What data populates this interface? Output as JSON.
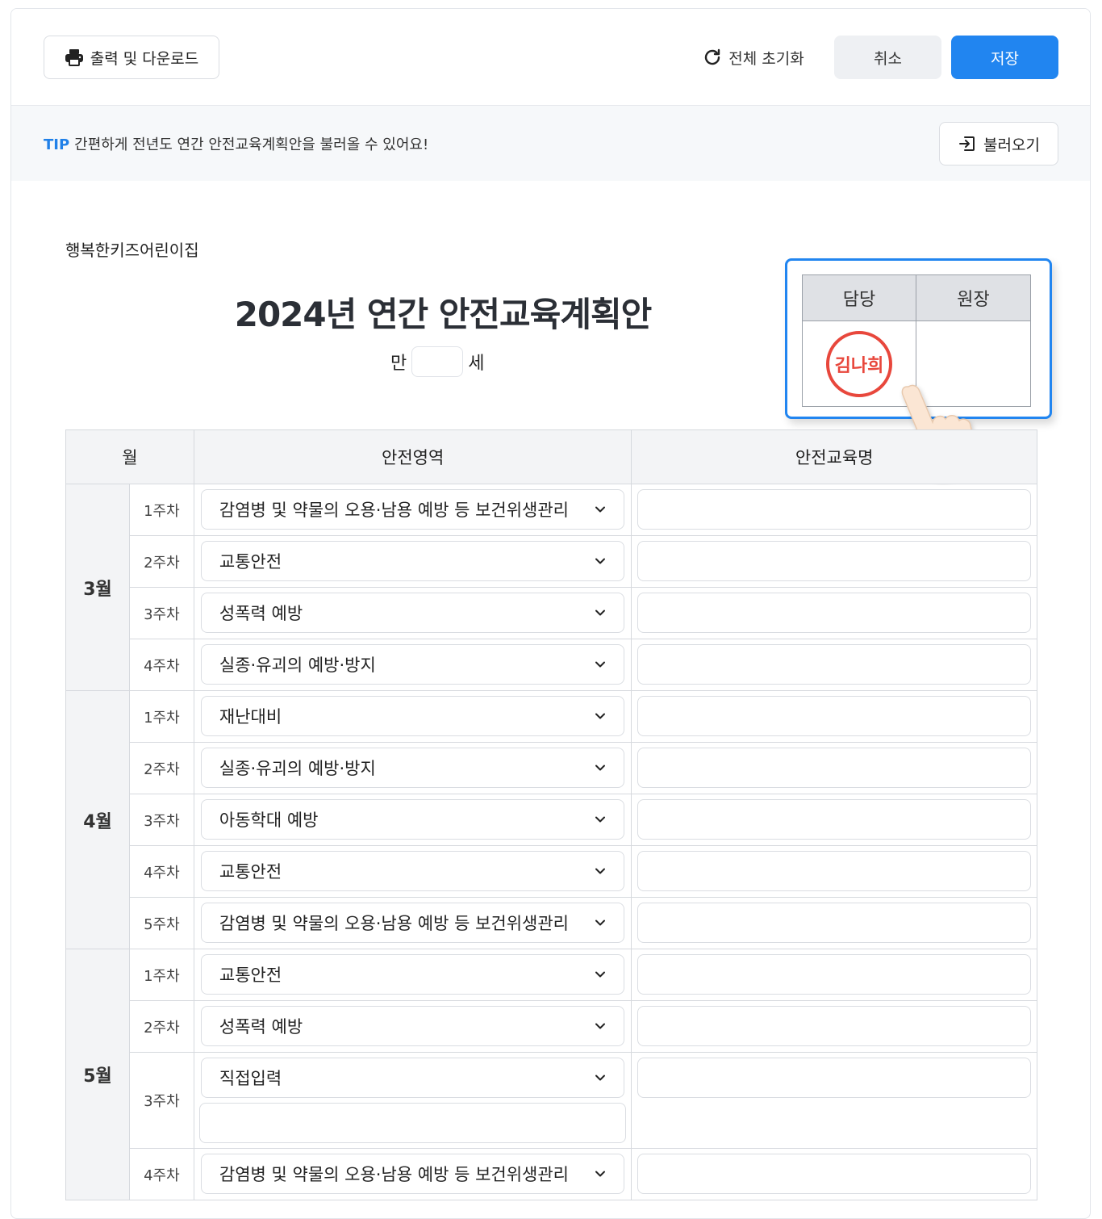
{
  "toolbar": {
    "print_label": "출력 및 다운로드",
    "reset_label": "전체 초기화",
    "cancel_label": "취소",
    "save_label": "저장"
  },
  "tip": {
    "label": "TIP",
    "text": "간편하게 전년도 연간 안전교육계획안을 불러올 수 있어요!",
    "load_label": "불러오기"
  },
  "document": {
    "org_name": "행복한키즈어린이집",
    "title": "2024년 연간 안전교육계획안",
    "age_prefix": "만",
    "age_value": "",
    "age_suffix": "세"
  },
  "approval": {
    "col1": "담당",
    "col2": "원장",
    "stamp_name": "김나희"
  },
  "table": {
    "headers": {
      "month": "월",
      "area": "안전영역",
      "name": "안전교육명"
    },
    "months": [
      {
        "label": "3월",
        "weeks": [
          {
            "week": "1주차",
            "area": "감염병 및 약물의 오용·남용 예방 등 보건위생관리",
            "name": ""
          },
          {
            "week": "2주차",
            "area": "교통안전",
            "name": ""
          },
          {
            "week": "3주차",
            "area": "성폭력 예방",
            "name": ""
          },
          {
            "week": "4주차",
            "area": "실종·유괴의 예방·방지",
            "name": ""
          }
        ]
      },
      {
        "label": "4월",
        "weeks": [
          {
            "week": "1주차",
            "area": "재난대비",
            "name": ""
          },
          {
            "week": "2주차",
            "area": "실종·유괴의 예방·방지",
            "name": ""
          },
          {
            "week": "3주차",
            "area": "아동학대 예방",
            "name": ""
          },
          {
            "week": "4주차",
            "area": "교통안전",
            "name": ""
          },
          {
            "week": "5주차",
            "area": "감염병 및 약물의 오용·남용 예방 등 보건위생관리",
            "name": ""
          }
        ]
      },
      {
        "label": "5월",
        "weeks": [
          {
            "week": "1주차",
            "area": "교통안전",
            "name": ""
          },
          {
            "week": "2주차",
            "area": "성폭력 예방",
            "name": ""
          },
          {
            "week": "3주차",
            "area": "직접입력",
            "custom": "",
            "name": ""
          },
          {
            "week": "4주차",
            "area": "감염병 및 약물의 오용·남용 예방 등 보건위생관리",
            "name": ""
          }
        ]
      }
    ]
  },
  "colors": {
    "accent": "#2185f0",
    "stamp": "#e8473c"
  }
}
